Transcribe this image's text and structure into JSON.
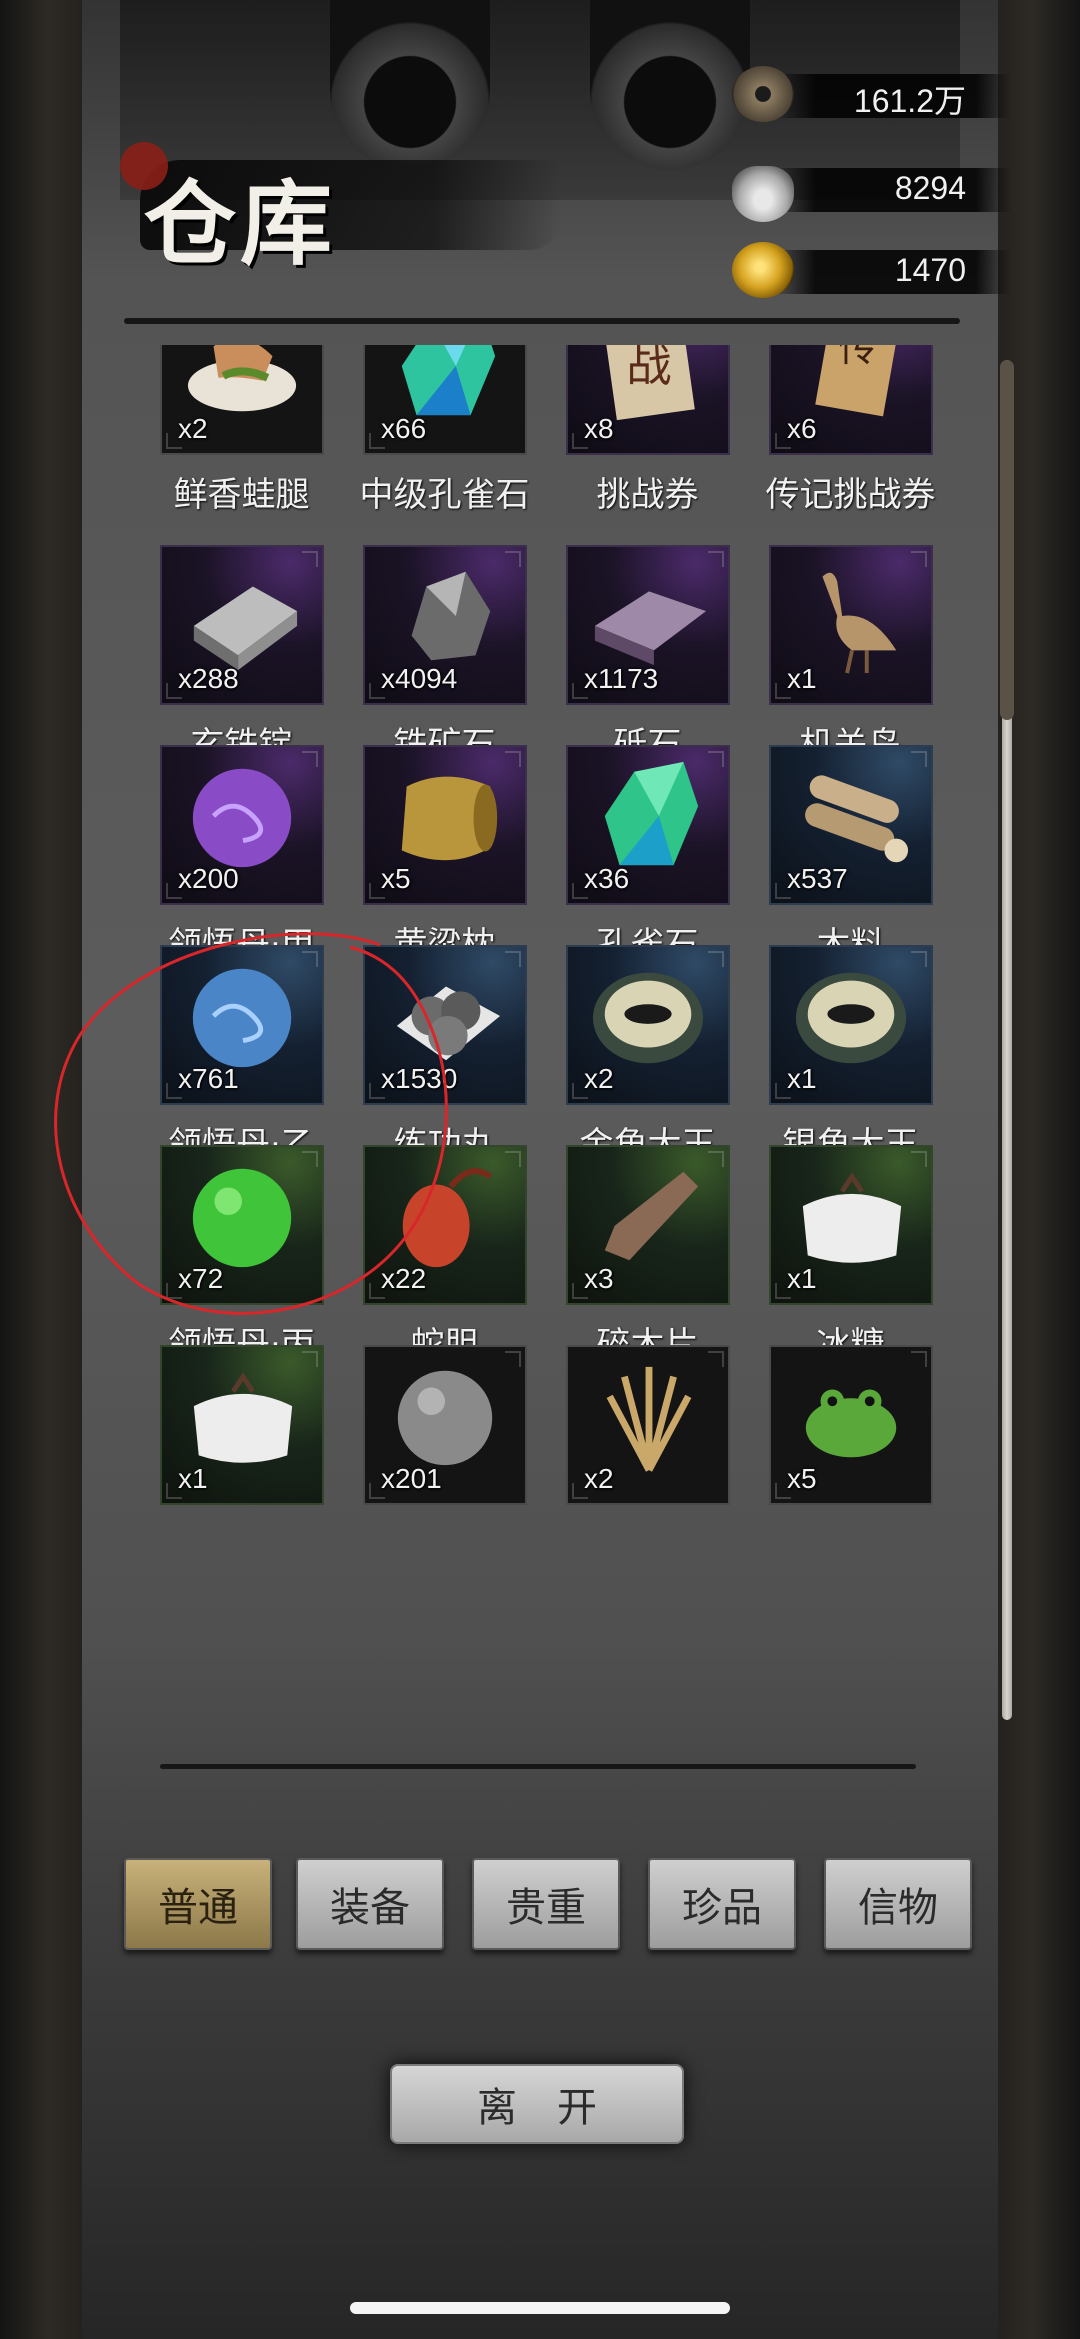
{
  "header": {
    "title": "仓库"
  },
  "currencies": [
    {
      "icon": "copper-coin-icon",
      "value": "161.2万"
    },
    {
      "icon": "silver-ingot-icon",
      "value": "8294"
    },
    {
      "icon": "gold-coin-icon",
      "value": "1470"
    }
  ],
  "items": [
    {
      "name": "鲜香蛙腿",
      "count": "x2",
      "rarity": "none",
      "icon": "frog-legs-icon"
    },
    {
      "name": "中级孔雀石",
      "count": "x66",
      "rarity": "none",
      "icon": "malachite-crystal-icon"
    },
    {
      "name": "挑战券",
      "count": "x8",
      "rarity": "purple",
      "icon": "challenge-ticket-icon"
    },
    {
      "name": "传记挑战券",
      "count": "x6",
      "rarity": "purple",
      "icon": "biography-ticket-icon"
    },
    {
      "name": "玄铁锭",
      "count": "x288",
      "rarity": "purple",
      "icon": "iron-ingot-icon"
    },
    {
      "name": "铁矿石",
      "count": "x4094",
      "rarity": "purple",
      "icon": "iron-ore-icon"
    },
    {
      "name": "砥石",
      "count": "x1173",
      "rarity": "purple",
      "icon": "whetstone-icon"
    },
    {
      "name": "机关鸟",
      "count": "x1",
      "rarity": "purple",
      "icon": "mechanical-bird-icon"
    },
    {
      "name": "领悟丹·甲",
      "count": "x200",
      "rarity": "purple",
      "icon": "purple-pill-icon"
    },
    {
      "name": "黄粱枕",
      "count": "x5",
      "rarity": "purple",
      "icon": "pillow-icon"
    },
    {
      "name": "孔雀石",
      "count": "x36",
      "rarity": "purple",
      "icon": "malachite-icon"
    },
    {
      "name": "木料",
      "count": "x537",
      "rarity": "blue",
      "icon": "wood-logs-icon"
    },
    {
      "name": "领悟丹·乙",
      "count": "x761",
      "rarity": "blue",
      "icon": "blue-pill-icon"
    },
    {
      "name": "练功丸",
      "count": "x1530",
      "rarity": "blue",
      "icon": "training-pills-icon"
    },
    {
      "name": "金角大王",
      "count": "x2",
      "rarity": "blue",
      "icon": "beetle-bowl-icon"
    },
    {
      "name": "银角大王",
      "count": "x1",
      "rarity": "blue",
      "icon": "beetle-bowl-icon"
    },
    {
      "name": "领悟丹·丙",
      "count": "x72",
      "rarity": "green",
      "icon": "green-pill-icon"
    },
    {
      "name": "蛇胆",
      "count": "x22",
      "rarity": "green",
      "icon": "snake-gall-icon"
    },
    {
      "name": "碎木片",
      "count": "x3",
      "rarity": "green",
      "icon": "wood-chip-icon"
    },
    {
      "name": "冰糖",
      "count": "x1",
      "rarity": "green",
      "icon": "sugar-bag-icon"
    },
    {
      "name": "",
      "count": "x1",
      "rarity": "green",
      "icon": "sugar-bag-icon"
    },
    {
      "name": "",
      "count": "x201",
      "rarity": "none",
      "icon": "gray-ball-icon"
    },
    {
      "name": "",
      "count": "x2",
      "rarity": "none",
      "icon": "wheat-bundle-icon"
    },
    {
      "name": "",
      "count": "x5",
      "rarity": "none",
      "icon": "frog-icon"
    }
  ],
  "tabs": [
    {
      "label": "普通",
      "active": true
    },
    {
      "label": "装备",
      "active": false
    },
    {
      "label": "贵重",
      "active": false
    },
    {
      "label": "珍品",
      "active": false
    },
    {
      "label": "信物",
      "active": false
    }
  ],
  "leave_button": {
    "label": "离开"
  },
  "colors": {
    "annotation_circle": "#d9262a",
    "active_tab": "#c8b17a"
  }
}
